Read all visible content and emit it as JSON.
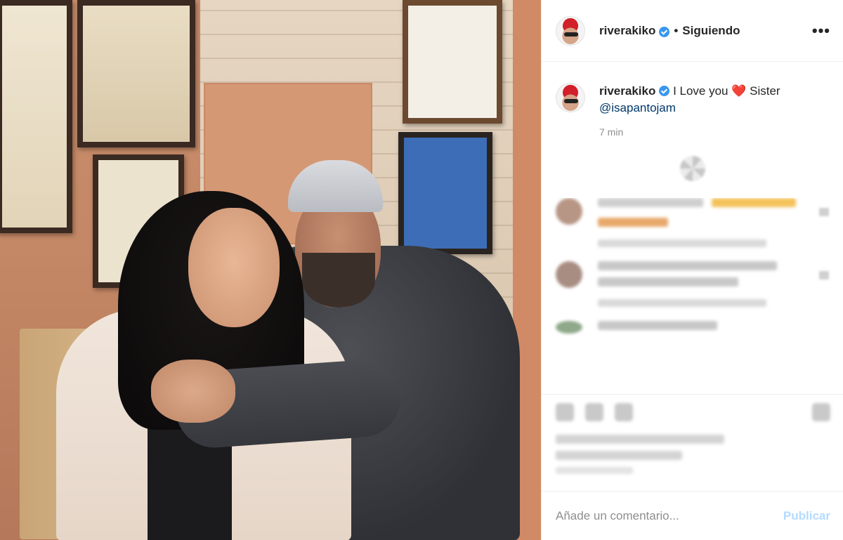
{
  "post": {
    "author": "riverakiko",
    "follow_status": "Siguiendo",
    "separator": "•",
    "more_glyph": "•••",
    "accent_color": "#3897f0",
    "icons": [
      "verified-badge-icon",
      "more-options-icon",
      "like-icon",
      "comment-icon",
      "share-icon",
      "save-icon"
    ]
  },
  "caption": {
    "username": "riverakiko",
    "text_before": " I Love you ",
    "heart": "❤️",
    "text_after": " Sister",
    "mention": "@isapantojam",
    "time": "7 min"
  },
  "comment_box": {
    "placeholder": "Añade un comentario...",
    "publish_label": "Publicar"
  }
}
